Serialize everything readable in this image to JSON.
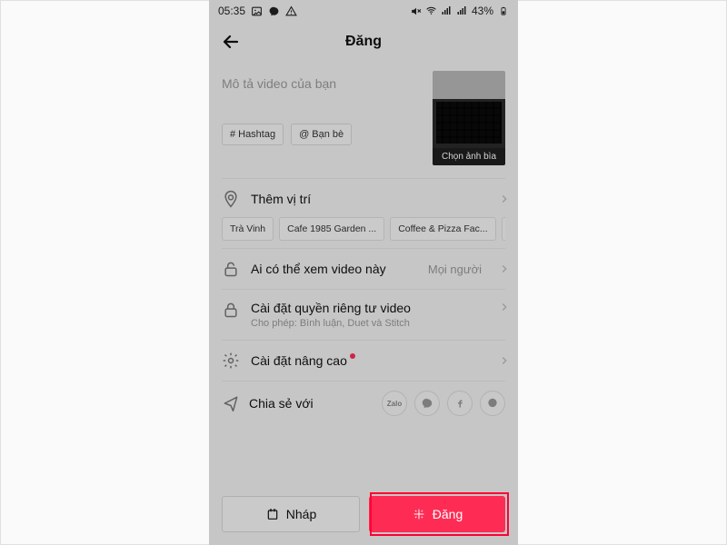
{
  "status": {
    "time": "05:35",
    "battery": "43%"
  },
  "nav": {
    "title": "Đăng"
  },
  "compose": {
    "placeholder": "Mô tả video của bạn",
    "hashtag": "Hashtag",
    "mention": "Bạn bè",
    "cover_label": "Chọn ảnh bìa"
  },
  "location": {
    "label": "Thêm vị trí",
    "chips": [
      "Trà Vinh",
      "Cafe 1985 Garden ...",
      "Coffee & Pizza Fac..."
    ]
  },
  "privacy": {
    "who_label": "Ai có thể xem video này",
    "who_value": "Mọi người",
    "settings_label": "Cài đặt quyền riêng tư video",
    "settings_sub": "Cho phép: Bình luận, Duet và Stitch"
  },
  "advanced": {
    "label": "Cài đặt nâng cao"
  },
  "share": {
    "label": "Chia sẻ với",
    "options": [
      "Zalo",
      "Messenger",
      "Facebook",
      "Chat"
    ]
  },
  "buttons": {
    "draft": "Nháp",
    "post": "Đăng"
  }
}
